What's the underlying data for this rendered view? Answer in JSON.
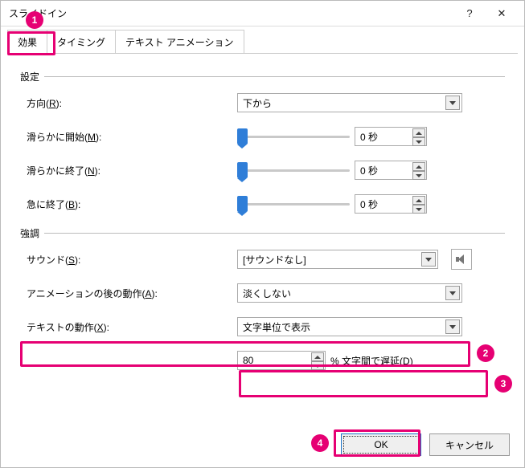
{
  "titlebar": {
    "title": "スライドイン",
    "help": "?",
    "close": "✕"
  },
  "tabs": [
    {
      "label": "効果"
    },
    {
      "label": "タイミング"
    },
    {
      "label": "テキスト アニメーション"
    }
  ],
  "groups": {
    "settings": "設定",
    "emphasis": "強調"
  },
  "settings": {
    "direction_label_pre": "方向(",
    "direction_hotkey": "R",
    "direction_label_post": "):",
    "direction_value": "下から",
    "smooth_start_label_pre": "滑らかに開始(",
    "smooth_start_hotkey": "M",
    "smooth_start_label_post": "):",
    "smooth_start_value": "0 秒",
    "smooth_end_label_pre": "滑らかに終了(",
    "smooth_end_hotkey": "N",
    "smooth_end_label_post": "):",
    "smooth_end_value": "0 秒",
    "bounce_end_label_pre": "急に終了(",
    "bounce_end_hotkey": "B",
    "bounce_end_label_post": "):",
    "bounce_end_value": "0 秒"
  },
  "emphasis": {
    "sound_label_pre": "サウンド(",
    "sound_hotkey": "S",
    "sound_label_post": "):",
    "sound_value": "[サウンドなし]",
    "after_label_pre": "アニメーションの後の動作(",
    "after_hotkey": "A",
    "after_label_post": "):",
    "after_value": "淡くしない",
    "text_anim_label_pre": "テキストの動作(",
    "text_anim_hotkey": "X",
    "text_anim_label_post": "):",
    "text_anim_value": "文字単位で表示",
    "delay_value": "80",
    "delay_suffix_pre": "% 文字間で遅延(",
    "delay_hotkey": "D",
    "delay_suffix_post": ")"
  },
  "buttons": {
    "ok": "OK",
    "cancel": "キャンセル"
  },
  "badges": {
    "b1": "1",
    "b2": "2",
    "b3": "3",
    "b4": "4"
  },
  "colors": {
    "accent": "#e60073",
    "slider": "#2f7ed8"
  }
}
